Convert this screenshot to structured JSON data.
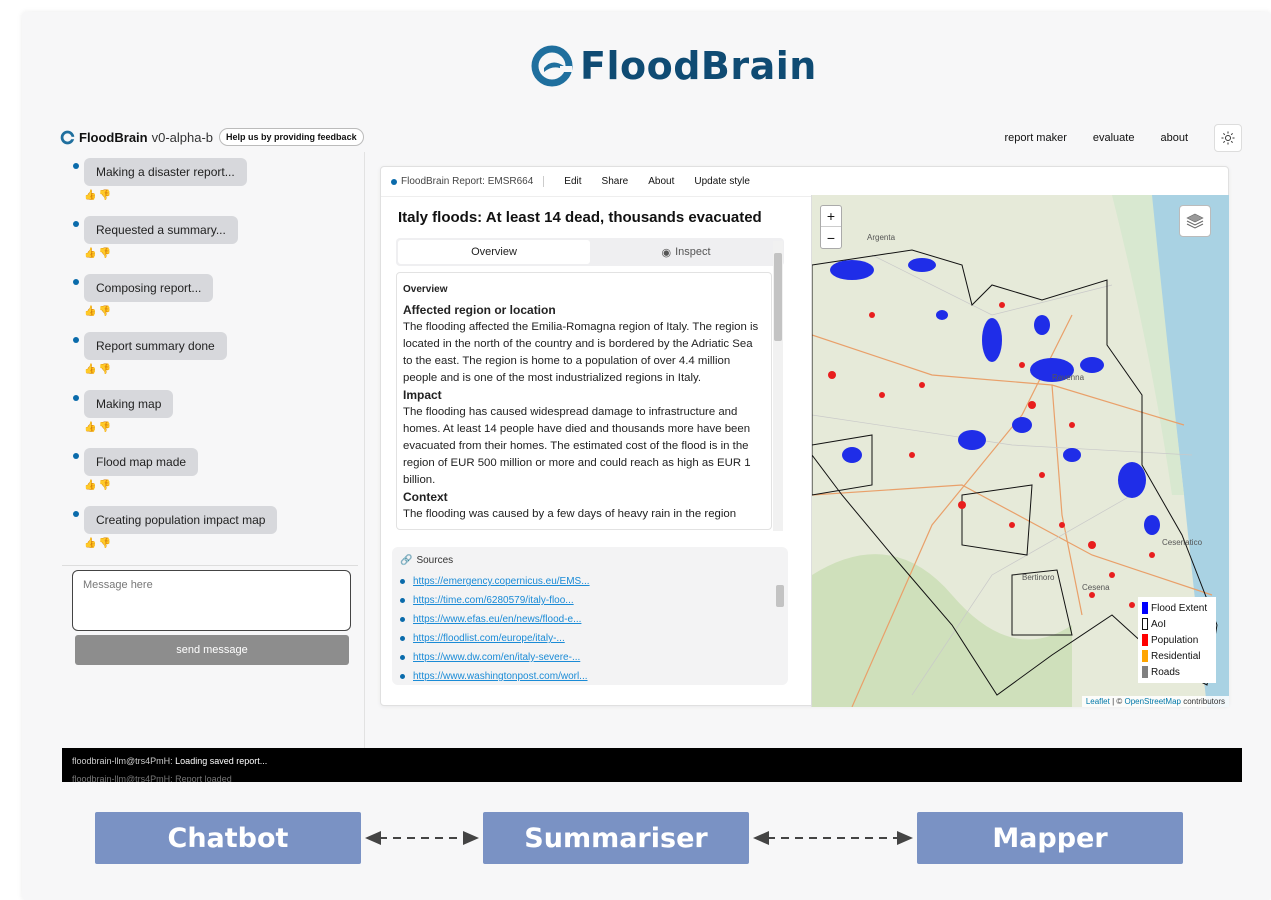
{
  "hero": {
    "logo_text": "FloodBrain"
  },
  "header": {
    "brand": "FloodBrain",
    "version": "v0-alpha-b",
    "feedback": "Help us by providing feedback",
    "nav": [
      "report maker",
      "evaluate",
      "about"
    ]
  },
  "chat": {
    "messages": [
      {
        "text": "Making a disaster report..."
      },
      {
        "text": "Requested a summary..."
      },
      {
        "text": "Composing report..."
      },
      {
        "text": "Report summary done"
      },
      {
        "text": "Making map"
      },
      {
        "text": "Flood map made"
      },
      {
        "text": "Creating population impact map"
      }
    ],
    "thumbs": "👍👎",
    "input_placeholder": "Message here",
    "send_label": "send message"
  },
  "report": {
    "tab_label": "FloodBrain Report: EMSR664",
    "menu": [
      "Edit",
      "Share",
      "About",
      "Update style"
    ],
    "title": "Italy floods: At least 14 dead, thousands evacuated",
    "tabs": [
      "Overview",
      "Inspect"
    ],
    "overview_heading": "Overview",
    "sections": [
      {
        "heading": "Affected region or location",
        "body": "The flooding affected the Emilia-Romagna region of Italy. The region is located in the north of the country and is bordered by the Adriatic Sea to the east. The region is home to a population of over 4.4 million people and is one of the most industrialized regions in Italy."
      },
      {
        "heading": "Impact",
        "body": "The flooding has caused widespread damage to infrastructure and homes. At least 14 people have died and thousands more have been evacuated from their homes. The estimated cost of the flood is in the region of EUR 500 million or more and could reach as high as EUR 1 billion."
      },
      {
        "heading": "Context",
        "body": "The flooding was caused by a few days of heavy rain in the region"
      }
    ],
    "sources_heading": "Sources",
    "sources": [
      "https://emergency.copernicus.eu/EMS...",
      "https://time.com/6280579/italy-floo...",
      "https://www.efas.eu/en/news/flood-e...",
      "https://floodlist.com/europe/italy-...",
      "https://www.dw.com/en/italy-severe-...",
      "https://www.washingtonpost.com/worl..."
    ]
  },
  "map": {
    "zoom_in": "+",
    "zoom_out": "−",
    "legend": [
      {
        "label": "Flood Extent",
        "color": "#0000ff"
      },
      {
        "label": "AoI",
        "color": "#ffffff"
      },
      {
        "label": "Population",
        "color": "#ff0000"
      },
      {
        "label": "Residential",
        "color": "#ffa500"
      },
      {
        "label": "Roads",
        "color": "#808080"
      }
    ],
    "place_labels": [
      "Argenta",
      "Ravenna",
      "Bertinoro",
      "Cesena",
      "Cesenatico"
    ],
    "attribution_leaflet": "Leaflet",
    "attribution_sep": " | © ",
    "attribution_osm": "OpenStreetMap",
    "attribution_tail": " contributors"
  },
  "terminal": {
    "host": "floodbrain-llm@trs4PmH:",
    "line1": " Loading saved report...",
    "line2": "floodbrain-llm@trs4PmH: Report loaded"
  },
  "pipeline": [
    "Chatbot",
    "Summariser",
    "Mapper"
  ]
}
